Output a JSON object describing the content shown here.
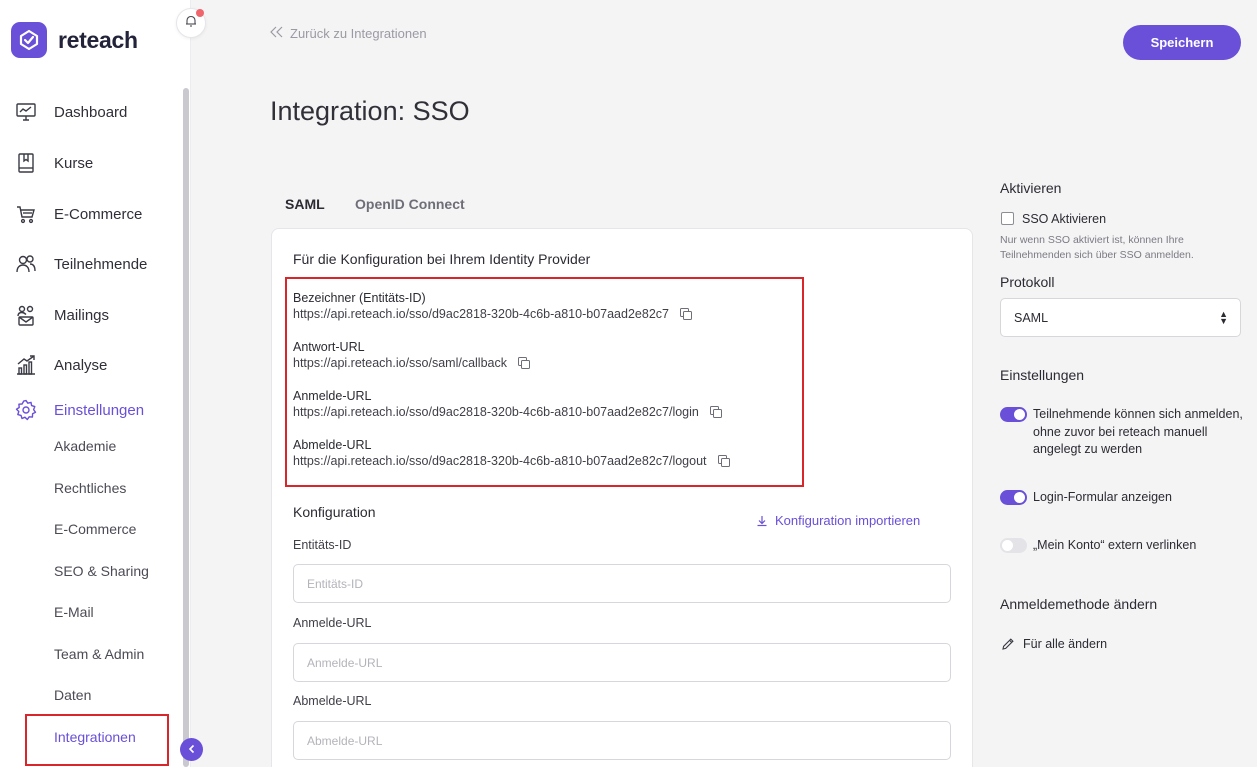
{
  "app": {
    "name": "reteach",
    "accent_color": "#6a4fd8",
    "highlight_color": "#d9262b"
  },
  "sidebar": {
    "items": [
      {
        "label": "Dashboard",
        "icon": "monitor-chart-icon"
      },
      {
        "label": "Kurse",
        "icon": "book-icon"
      },
      {
        "label": "E-Commerce",
        "icon": "cart-icon"
      },
      {
        "label": "Teilnehmende",
        "icon": "users-icon"
      },
      {
        "label": "Mailings",
        "icon": "mailing-users-icon"
      },
      {
        "label": "Analyse",
        "icon": "analytics-icon"
      },
      {
        "label": "Einstellungen",
        "icon": "gear-icon"
      }
    ],
    "subitems": [
      "Akademie",
      "Rechtliches",
      "E-Commerce",
      "SEO & Sharing",
      "E-Mail",
      "Team & Admin",
      "Daten",
      "Integrationen"
    ]
  },
  "header": {
    "back_label": "Zurück zu Integrationen",
    "save_label": "Speichern",
    "title": "Integration: SSO"
  },
  "tabs": [
    "SAML",
    "OpenID Connect"
  ],
  "idp": {
    "heading": "Für die Konfiguration bei Ihrem Identity Provider",
    "entries": [
      {
        "label": "Bezeichner (Entitäts-ID)",
        "url": "https://api.reteach.io/sso/d9ac2818-320b-4c6b-a810-b07aad2e82c7"
      },
      {
        "label": "Antwort-URL",
        "url": "https://api.reteach.io/sso/saml/callback"
      },
      {
        "label": "Anmelde-URL",
        "url": "https://api.reteach.io/sso/d9ac2818-320b-4c6b-a810-b07aad2e82c7/login"
      },
      {
        "label": "Abmelde-URL",
        "url": "https://api.reteach.io/sso/d9ac2818-320b-4c6b-a810-b07aad2e82c7/logout"
      }
    ]
  },
  "konfiguration": {
    "title": "Konfiguration",
    "import_label": "Konfiguration importieren",
    "fields": [
      {
        "label": "Entitäts-ID",
        "placeholder": "Entitäts-ID",
        "value": ""
      },
      {
        "label": "Anmelde-URL",
        "placeholder": "Anmelde-URL",
        "value": ""
      },
      {
        "label": "Abmelde-URL",
        "placeholder": "Abmelde-URL",
        "value": ""
      }
    ]
  },
  "right_panel": {
    "aktivieren_title": "Aktivieren",
    "sso_checkbox_label": "SSO Aktivieren",
    "sso_checked": false,
    "sso_help": "Nur wenn SSO aktiviert ist, können Ihre Teilnehmenden sich über SSO anmelden.",
    "protokoll_title": "Protokoll",
    "protokoll_value": "SAML",
    "einstellungen_title": "Einstellungen",
    "toggles": [
      {
        "label": "Teilnehmende können sich anmelden, ohne zuvor bei reteach manuell angelegt zu werden",
        "on": true
      },
      {
        "label": "Login-Formular anzeigen",
        "on": true
      },
      {
        "label": "„Mein Konto“ extern verlinken",
        "on": false
      }
    ],
    "anmeldemethode_title": "Anmeldemethode ändern",
    "change_all_label": "Für alle ändern"
  }
}
